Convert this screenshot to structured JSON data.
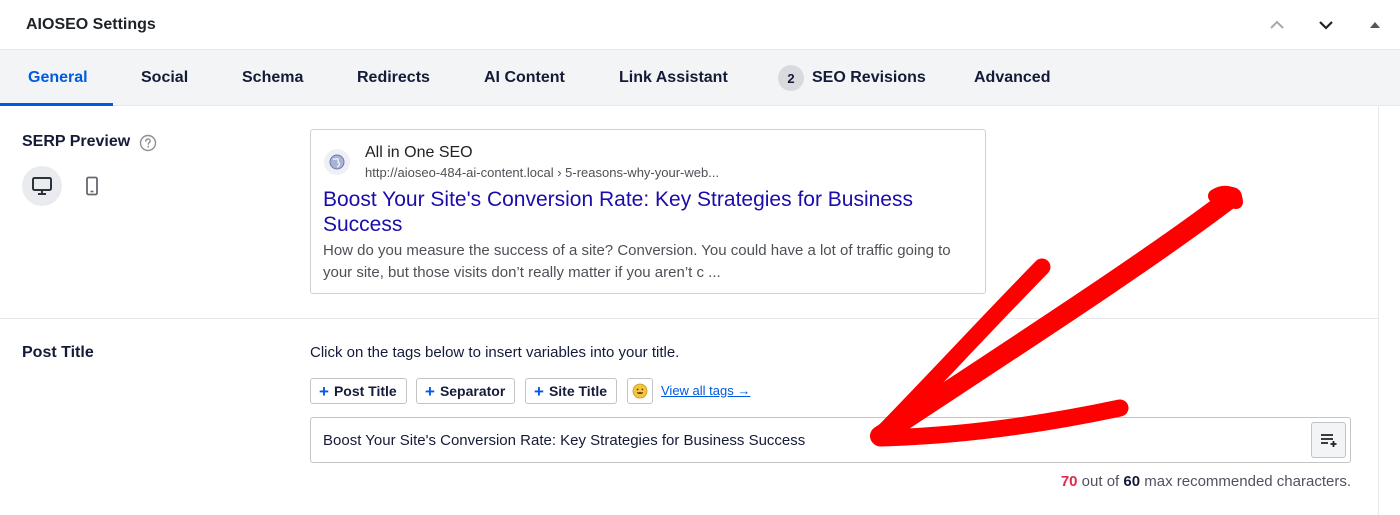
{
  "panel": {
    "title": "AIOSEO Settings"
  },
  "tabs": [
    {
      "label": "General",
      "active": true
    },
    {
      "label": "Social"
    },
    {
      "label": "Schema"
    },
    {
      "label": "Redirects"
    },
    {
      "label": "AI Content"
    },
    {
      "label": "Link Assistant"
    },
    {
      "label": "SEO Revisions",
      "badge": "2"
    },
    {
      "label": "Advanced"
    }
  ],
  "serp_preview": {
    "label": "SERP Preview",
    "help_icon": "question-circle-icon",
    "devices": [
      {
        "name": "desktop",
        "icon": "desktop-icon",
        "active": true
      },
      {
        "name": "mobile",
        "icon": "mobile-icon",
        "active": false
      }
    ],
    "site_name": "All in One SEO",
    "url": "http://aioseo-484-ai-content.local › 5-reasons-why-your-web...",
    "title": "Boost Your Site's Conversion Rate: Key Strategies for Business Success",
    "description": "How do you measure the success of a site? Conversion. You could have a lot of traffic going to your site, but those visits don’t really matter if you aren’t c ..."
  },
  "post_title": {
    "label": "Post Title",
    "helper": "Click on the tags below to insert variables into your title.",
    "tags": [
      "Post Title",
      "Separator",
      "Site Title"
    ],
    "emoji_icon": "smiley-icon",
    "view_all": "View all tags →",
    "value": "Boost Your Site's Conversion Rate: Key Strategies for Business Success",
    "count": "70",
    "count_mid": " out of ",
    "max": "60",
    "count_suffix": " max recommended characters."
  },
  "colors": {
    "accent": "#005ae0",
    "serp_title": "#1a0dab",
    "over_limit": "#df2a4a",
    "annotation_arrow": "#ff0000"
  }
}
